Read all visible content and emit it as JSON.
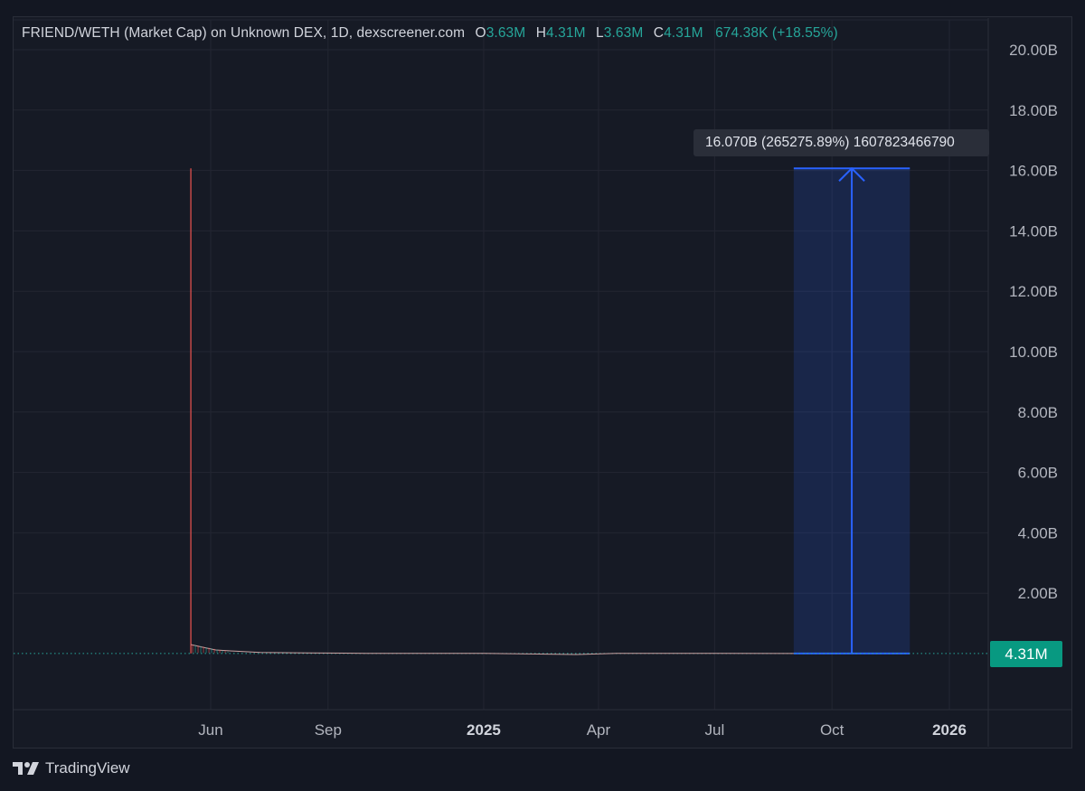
{
  "legend": {
    "title": "FRIEND/WETH (Market Cap) on Unknown DEX, 1D, dexscreener.com",
    "open_label": "O",
    "open_value": "3.63M",
    "high_label": "H",
    "high_value": "4.31M",
    "low_label": "L",
    "low_value": "3.63M",
    "close_label": "C",
    "close_value": "4.31M",
    "change": "674.38K (+18.55%)"
  },
  "measure_tool": {
    "label": "16.070B (265275.89%) 1607823466790"
  },
  "price_badge": "4.31M",
  "footer": {
    "brand": "TradingView"
  },
  "colors": {
    "background": "#131722",
    "grid": "#232632",
    "up": "#26a69a",
    "down": "#ef5350",
    "measure": "#2962ff",
    "badge": "#089981"
  },
  "chart_data": {
    "type": "line",
    "title": "FRIEND/WETH (Market Cap) on Unknown DEX, 1D, dexscreener.com",
    "ylabel": "",
    "xlabel": "",
    "y_ticks": [
      "20.00B",
      "18.00B",
      "16.00B",
      "14.00B",
      "12.00B",
      "10.00B",
      "8.00B",
      "6.00B",
      "4.00B",
      "2.00B"
    ],
    "x_ticks": [
      {
        "label": "Jun",
        "bold": false
      },
      {
        "label": "Sep",
        "bold": false
      },
      {
        "label": "2025",
        "bold": true
      },
      {
        "label": "Apr",
        "bold": false
      },
      {
        "label": "Jul",
        "bold": false
      },
      {
        "label": "Oct",
        "bold": false
      },
      {
        "label": "2026",
        "bold": true
      }
    ],
    "ylim": [
      -1.3,
      20.0
    ],
    "y_unit": "B",
    "grid": true,
    "series": [
      {
        "values_note": "market cap in billions",
        "spike": {
          "date": "2024-05-20",
          "high": 16.07,
          "low": 0.0036
        },
        "points": [
          {
            "date": "2024-05-20",
            "value": 0.3
          },
          {
            "date": "2024-05-25",
            "value": 0.22
          },
          {
            "date": "2024-06-05",
            "value": 0.12
          },
          {
            "date": "2024-06-20",
            "value": 0.08
          },
          {
            "date": "2024-07-10",
            "value": 0.04
          },
          {
            "date": "2024-08-15",
            "value": 0.02
          },
          {
            "date": "2024-10-01",
            "value": 0.01
          },
          {
            "date": "2025-01-01",
            "value": 0.008
          },
          {
            "date": "2025-03-15",
            "value": -0.03
          },
          {
            "date": "2025-04-15",
            "value": 0.006
          },
          {
            "date": "2025-07-01",
            "value": 0.005
          },
          {
            "date": "2025-09-01",
            "value": 0.0043
          }
        ]
      }
    ],
    "last_value": 0.00431,
    "measurement": {
      "from_date": "2025-09-01",
      "to_date": "2025-12-01",
      "from_value": 0.0043,
      "to_value": 16.07
    }
  }
}
